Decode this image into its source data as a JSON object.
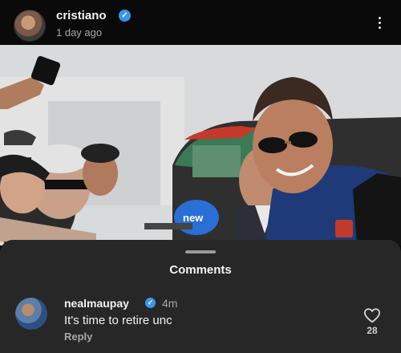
{
  "post": {
    "username": "cristiano",
    "verified": true,
    "timestamp": "1 day ago",
    "more_icon": "more-vertical-icon",
    "photo_caption_text": "new"
  },
  "comments_sheet": {
    "title": "Comments",
    "comments": [
      {
        "username": "nealmaupay",
        "verified": true,
        "time": "4m",
        "text": "It's time to retire unc",
        "reply_label": "Reply",
        "like_icon": "heart-outline-icon",
        "like_count": "28"
      }
    ]
  },
  "colors": {
    "verified_blue": "#3897f0",
    "sheet_bg": "#272727",
    "header_bg": "#0a0a0a"
  }
}
